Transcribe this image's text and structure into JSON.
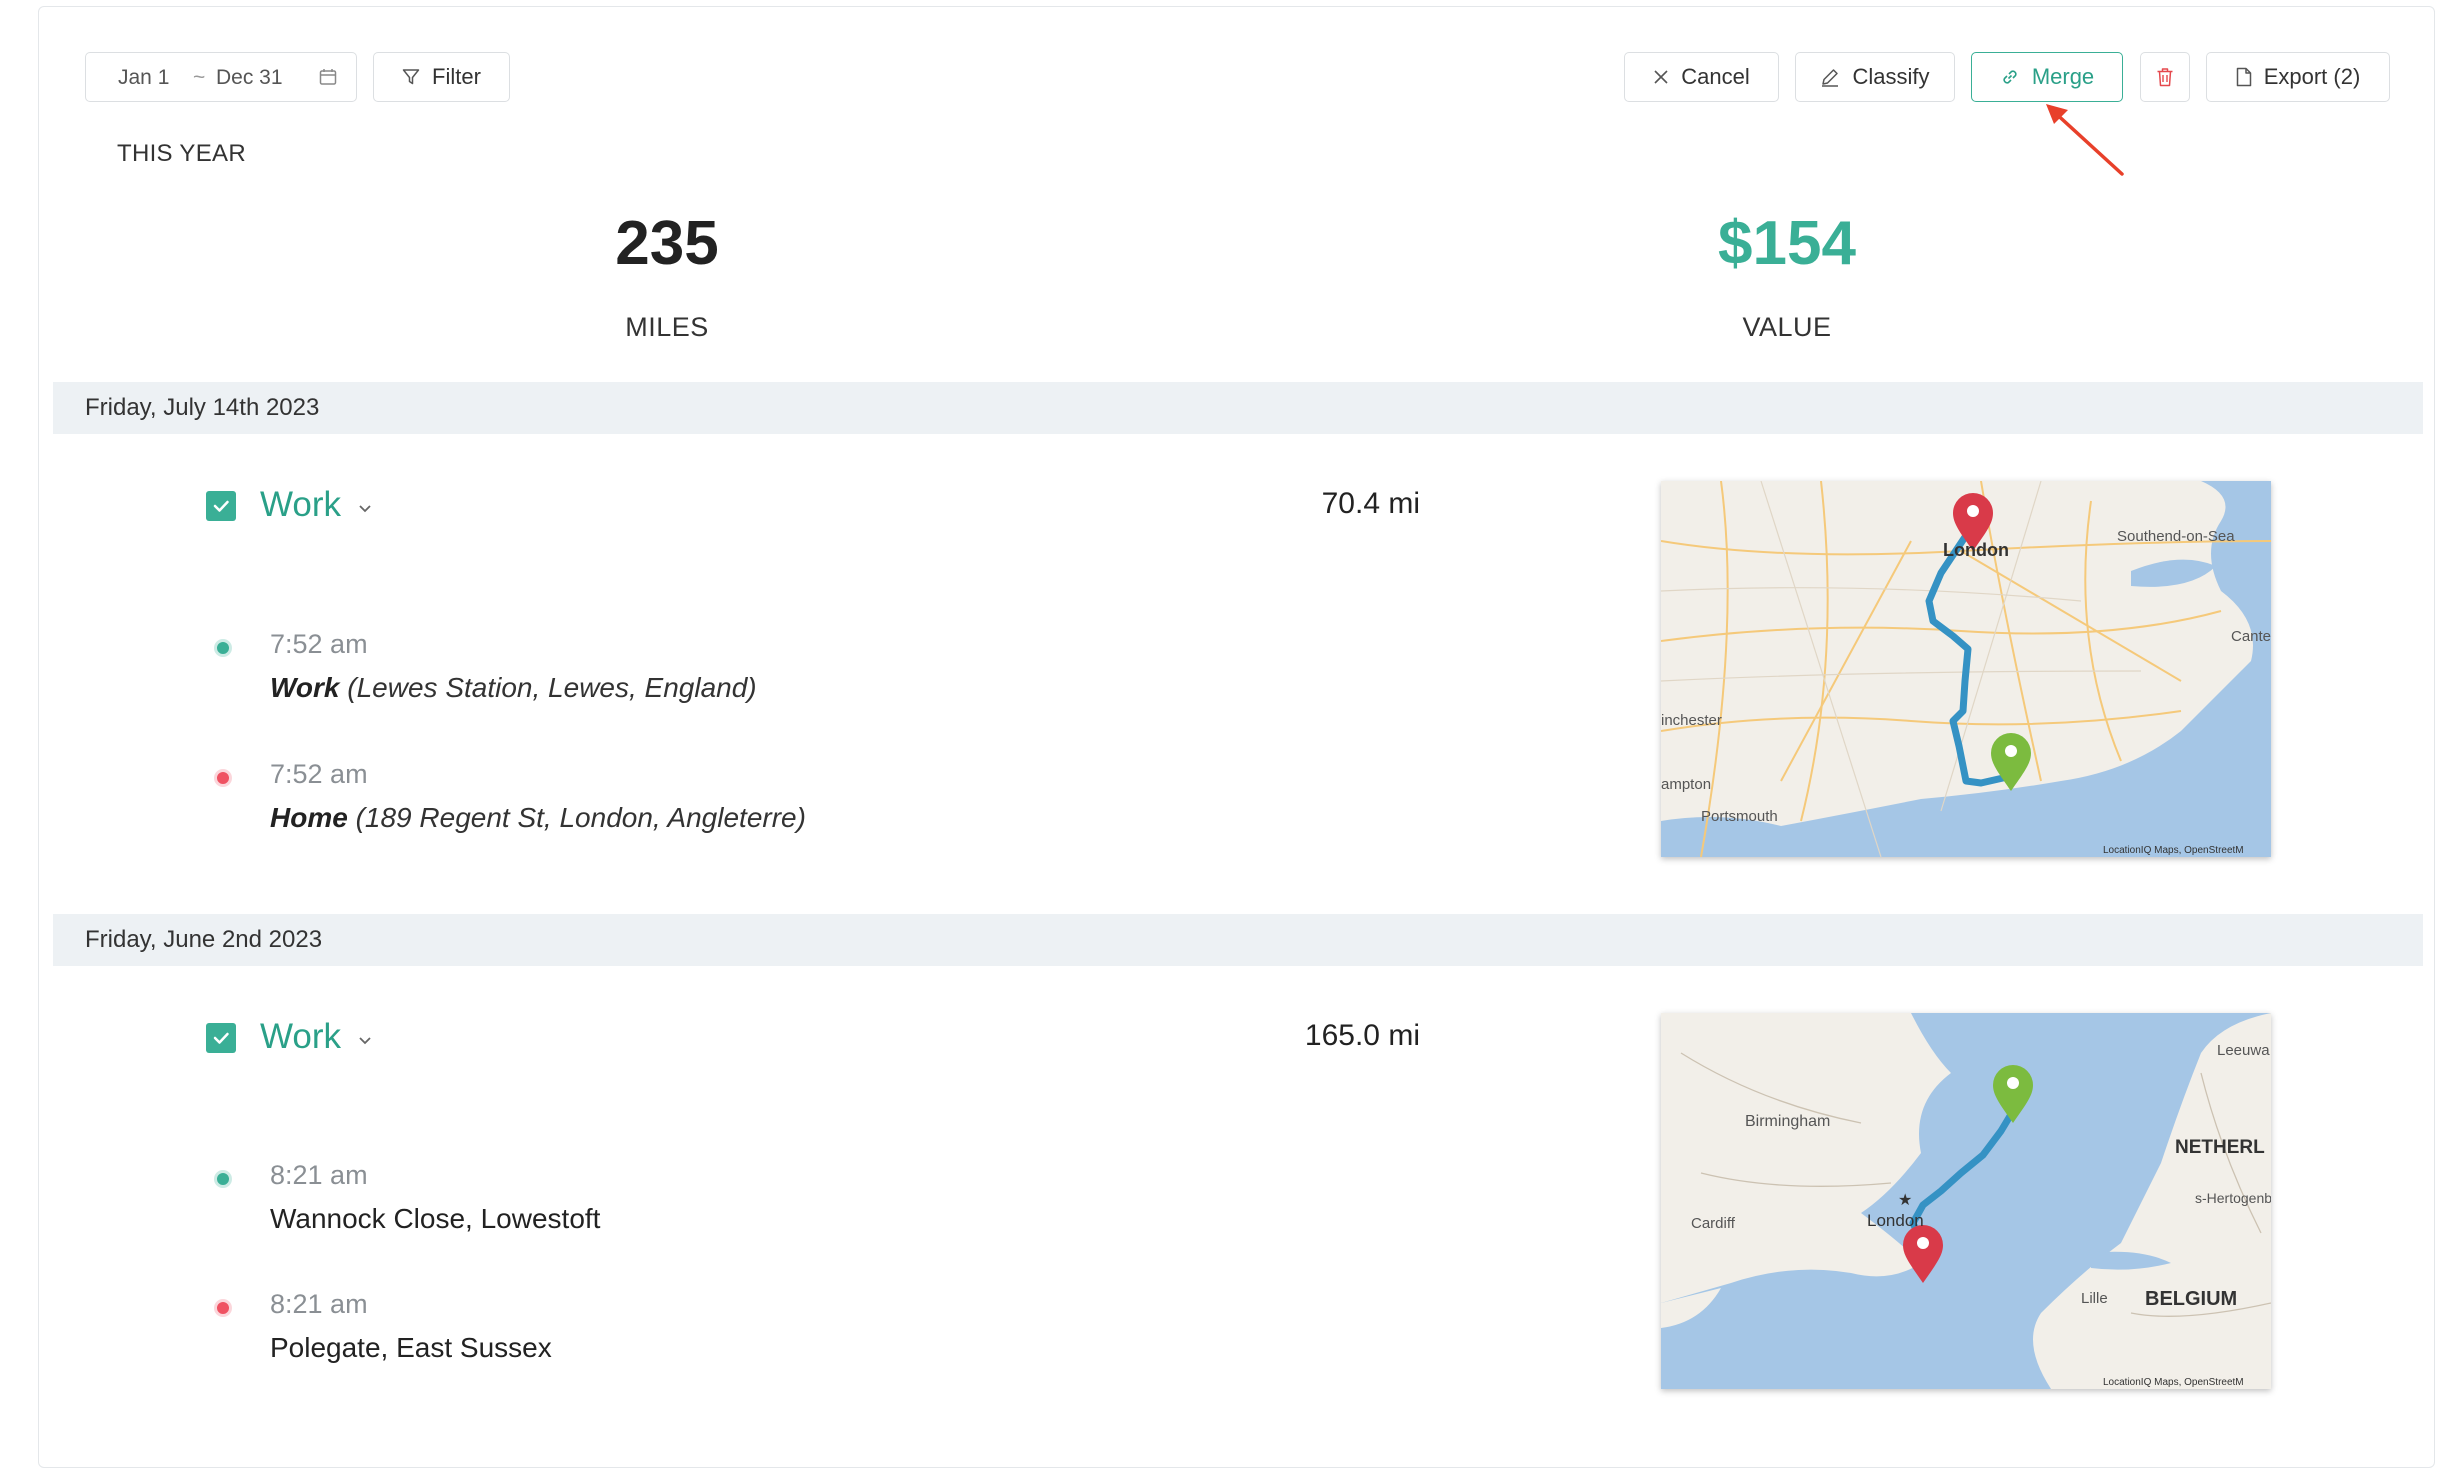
{
  "toolbar": {
    "date_from": "Jan 1",
    "date_sep": "~",
    "date_to": "Dec 31",
    "filter_label": "Filter",
    "cancel_label": "Cancel",
    "classify_label": "Classify",
    "merge_label": "Merge",
    "export_label": "Export (2)"
  },
  "summary": {
    "period": "THIS YEAR",
    "miles_value": "235",
    "miles_label": "MILES",
    "value_value": "$154",
    "value_label": "VALUE"
  },
  "colors": {
    "accent": "#3aaf96",
    "start_dot": "#3aaf96",
    "end_dot": "#ef5262",
    "annotation_arrow": "#e8402a"
  },
  "trips": [
    {
      "date": "Friday, July 14th 2023",
      "category": "Work",
      "distance": "70.4 mi",
      "start_time": "7:52 am",
      "start_name": "Work",
      "start_address": "(Lewes Station, Lewes, England)",
      "end_time": "7:52 am",
      "end_name": "Home",
      "end_address": "(189 Regent St, London, Angleterre)",
      "map": {
        "labels": [
          "London",
          "Southend-on-Sea",
          "Cante",
          "inchester",
          "ampton",
          "Portsmouth"
        ],
        "credit": "LocationIQ Maps, OpenStreetM"
      }
    },
    {
      "date": "Friday, June 2nd 2023",
      "category": "Work",
      "distance": "165.0 mi",
      "start_time": "8:21 am",
      "start_place": "Wannock Close, Lowestoft",
      "end_time": "8:21 am",
      "end_place": "Polegate, East Sussex",
      "map": {
        "labels": [
          "Leeuwa",
          "Birmingham",
          "NETHERL",
          "s-Hertogenbo",
          "Cardiff",
          "London",
          "Lille",
          "BELGIUM"
        ],
        "credit": "LocationIQ Maps, OpenStreetM"
      }
    }
  ]
}
